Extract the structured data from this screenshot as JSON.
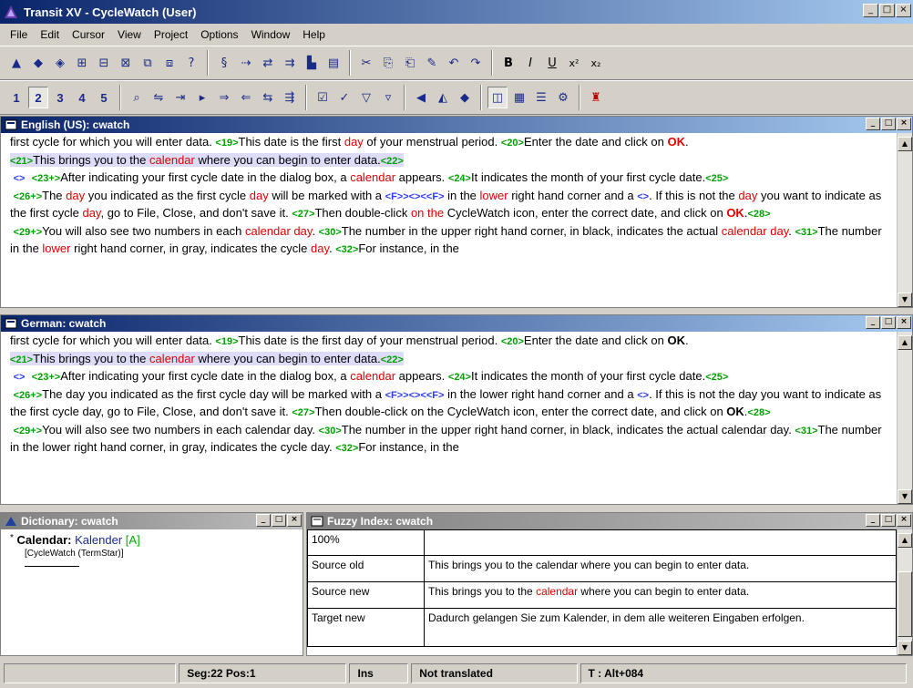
{
  "window": {
    "title": "Transit XV - CycleWatch (User)"
  },
  "menu": [
    "File",
    "Edit",
    "Cursor",
    "View",
    "Project",
    "Options",
    "Window",
    "Help"
  ],
  "toolbar2": {
    "numbers": [
      "1",
      "2",
      "3",
      "4",
      "5"
    ],
    "pressed": "2"
  },
  "source_panel": {
    "title": "English (US): cwatch",
    "segments": [
      {
        "prefix": "",
        "pre": "first cycle for which you will enter data. ",
        "tag": "<19>",
        "text": "This date is the first ",
        "hl": "day",
        "rest": " of your menstrual period. ",
        "tag2": "<20>",
        "text2": "Enter the date and click on ",
        "hlb": "OK",
        "rest2": "."
      },
      {
        "tag": "<21>",
        "text": "This brings you to the ",
        "hl": "calendar",
        "rest": " where you can begin to enter data.",
        "tag2": "<22>"
      },
      {
        "tagb": "<>",
        "tag": "<23+>",
        "text": "After indicating your first cycle date in the dialog box, a ",
        "hl": "calendar",
        "rest": " appears. ",
        "tag2": "<24>",
        "text2": "It indicates the month of your first cycle date.",
        "tag3": "<25>"
      },
      {
        "tag": "<26+>",
        "text": "The ",
        "hl": "day",
        "rest": " you indicated as the first cycle ",
        "hl2": "day",
        "rest2": " will be marked with a ",
        "tagb": "<F>><><<F>",
        "rest3": " in the ",
        "hl3": "lower",
        "rest4": " right hand corner and a ",
        "tagb2": "<>",
        "rest5": ". If this is not the ",
        "hl4": "day",
        "rest6": " you want to indicate as the first cycle ",
        "hl5": "day",
        "rest7": ", go to File, Close, and don't save it. ",
        "tag2": "<27>",
        "text2": "Then double-click ",
        "hl6": "on the",
        "rest8": " CycleWatch icon, enter the correct date, and click on ",
        "hlb": "OK",
        "rest9": ".",
        "tag3": "<28>"
      },
      {
        "tag": "<29+>",
        "text": "You will also see two numbers in each ",
        "hl": "calendar day",
        "rest": ". ",
        "tag2": "<30>",
        "text2": "The number in the upper right hand corner, in black, indicates the actual ",
        "hl2": "calendar day",
        "rest2": ". ",
        "tag3": "<31>",
        "text3": "The number in the ",
        "hl3": "lower",
        "rest3": " right hand corner, in gray, indicates the cycle ",
        "hl4": "day",
        "rest4": ". ",
        "tag4": "<32>",
        "text4": "For instance, in the"
      }
    ]
  },
  "target_panel": {
    "title": "German: cwatch",
    "segments": [
      {
        "pre": "first cycle for which you will enter data. ",
        "tag": "<19>",
        "text": "This date is the first day of your menstrual period. ",
        "tag2": "<20>",
        "text2": "Enter the date and click on ",
        "hlb": "OK",
        "rest2": "."
      },
      {
        "tag": "<21>",
        "text": "This brings you to the ",
        "hl": "calendar",
        "rest": " where you can begin to enter data.",
        "tag2": "<22>"
      },
      {
        "tagb": "<>",
        "tag": "<23+>",
        "text": "After indicating your first cycle date in the dialog box, a ",
        "hl": "calendar",
        "rest": " appears. ",
        "tag2": "<24>",
        "text2": "It indicates the month of your first cycle date.",
        "tag3": "<25>"
      },
      {
        "tag": "<26+>",
        "text": "The day you indicated as the first cycle day will be marked with a ",
        "tagb": "<F>><><<F>",
        "rest": " in the lower right hand corner and a ",
        "tagb2": "<>",
        "rest2": ". If this is not the day you want to indicate as the first cycle day, go to File, Close, and don't save it. ",
        "tag2": "<27>",
        "text2": "Then double-click on the CycleWatch icon, enter the correct date, and click on ",
        "hlb": "OK",
        "rest3": ".",
        "tag3": "<28>"
      },
      {
        "tag": "<29+>",
        "text": "You will also see two numbers in each calendar day. ",
        "tag2": "<30>",
        "text2": "The number in the upper right hand corner, in black, indicates the actual calendar day. ",
        "tag3": "<31>",
        "text3": "The number in the lower right hand corner, in gray, indicates the cycle day. ",
        "tag4": "<32>",
        "text4": "For instance, in the"
      }
    ]
  },
  "dictionary": {
    "title": "Dictionary: cwatch",
    "term": "Calendar:",
    "translation": "Kalender",
    "flag": "[A]",
    "source": "[CycleWatch (TermStar)]"
  },
  "fuzzy": {
    "title": "Fuzzy Index: cwatch",
    "match": "100%",
    "rows": [
      {
        "label": "Source old",
        "text": "This brings you to the calendar where you can begin to enter data."
      },
      {
        "label": "Source new",
        "pre": "This brings you to the ",
        "hl": "calendar",
        "post": " where you can begin to enter data."
      },
      {
        "label": "Target new",
        "text": "Dadurch gelangen Sie zum Kalender, in dem alle weiteren Eingaben erfolgen."
      }
    ]
  },
  "status": {
    "segpos": "Seg:22 Pos:1",
    "mode": "Ins",
    "state": "Not translated",
    "shortcut": "T : Alt+084"
  },
  "colors": {
    "tag": "#00a000",
    "tag_blue": "#2a3cff",
    "highlight": "#e00000",
    "titlebar": "#0a246a"
  }
}
